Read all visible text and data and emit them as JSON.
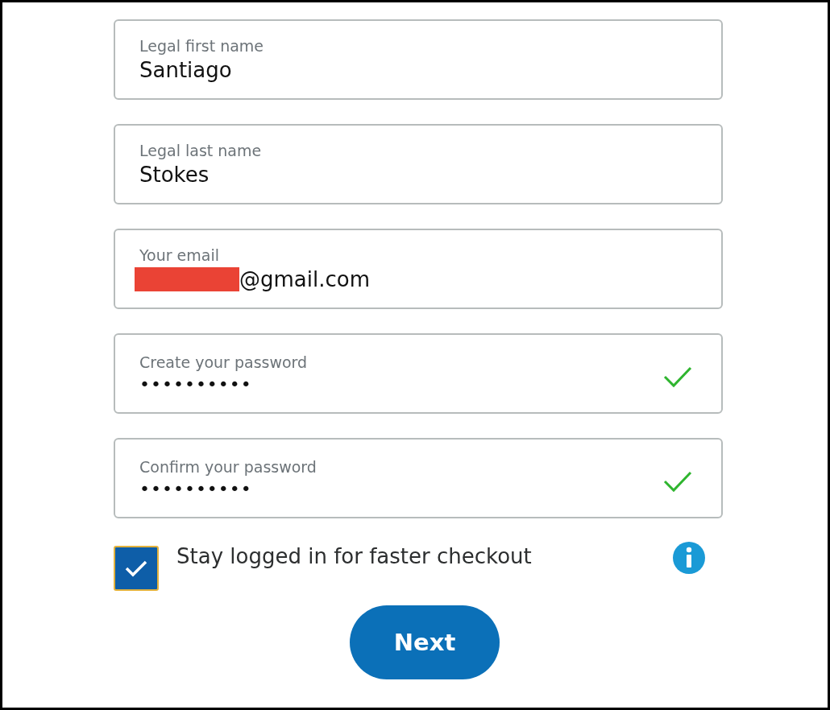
{
  "fields": [
    {
      "label": "Legal first name",
      "value": "Santiago",
      "redacted": false,
      "valid": false
    },
    {
      "label": "Legal last name",
      "value": "Stokes",
      "redacted": false,
      "valid": false
    },
    {
      "label": "Your email",
      "value": "@gmail.com",
      "redacted": true,
      "valid": false
    },
    {
      "label": "Create your password",
      "value": "••••••••••",
      "redacted": false,
      "valid": true
    },
    {
      "label": "Confirm your password",
      "value": "••••••••••",
      "redacted": false,
      "valid": true
    }
  ],
  "stay_logged_in": {
    "label": "Stay logged in for faster checkout",
    "checked": true
  },
  "next_button": "Next"
}
